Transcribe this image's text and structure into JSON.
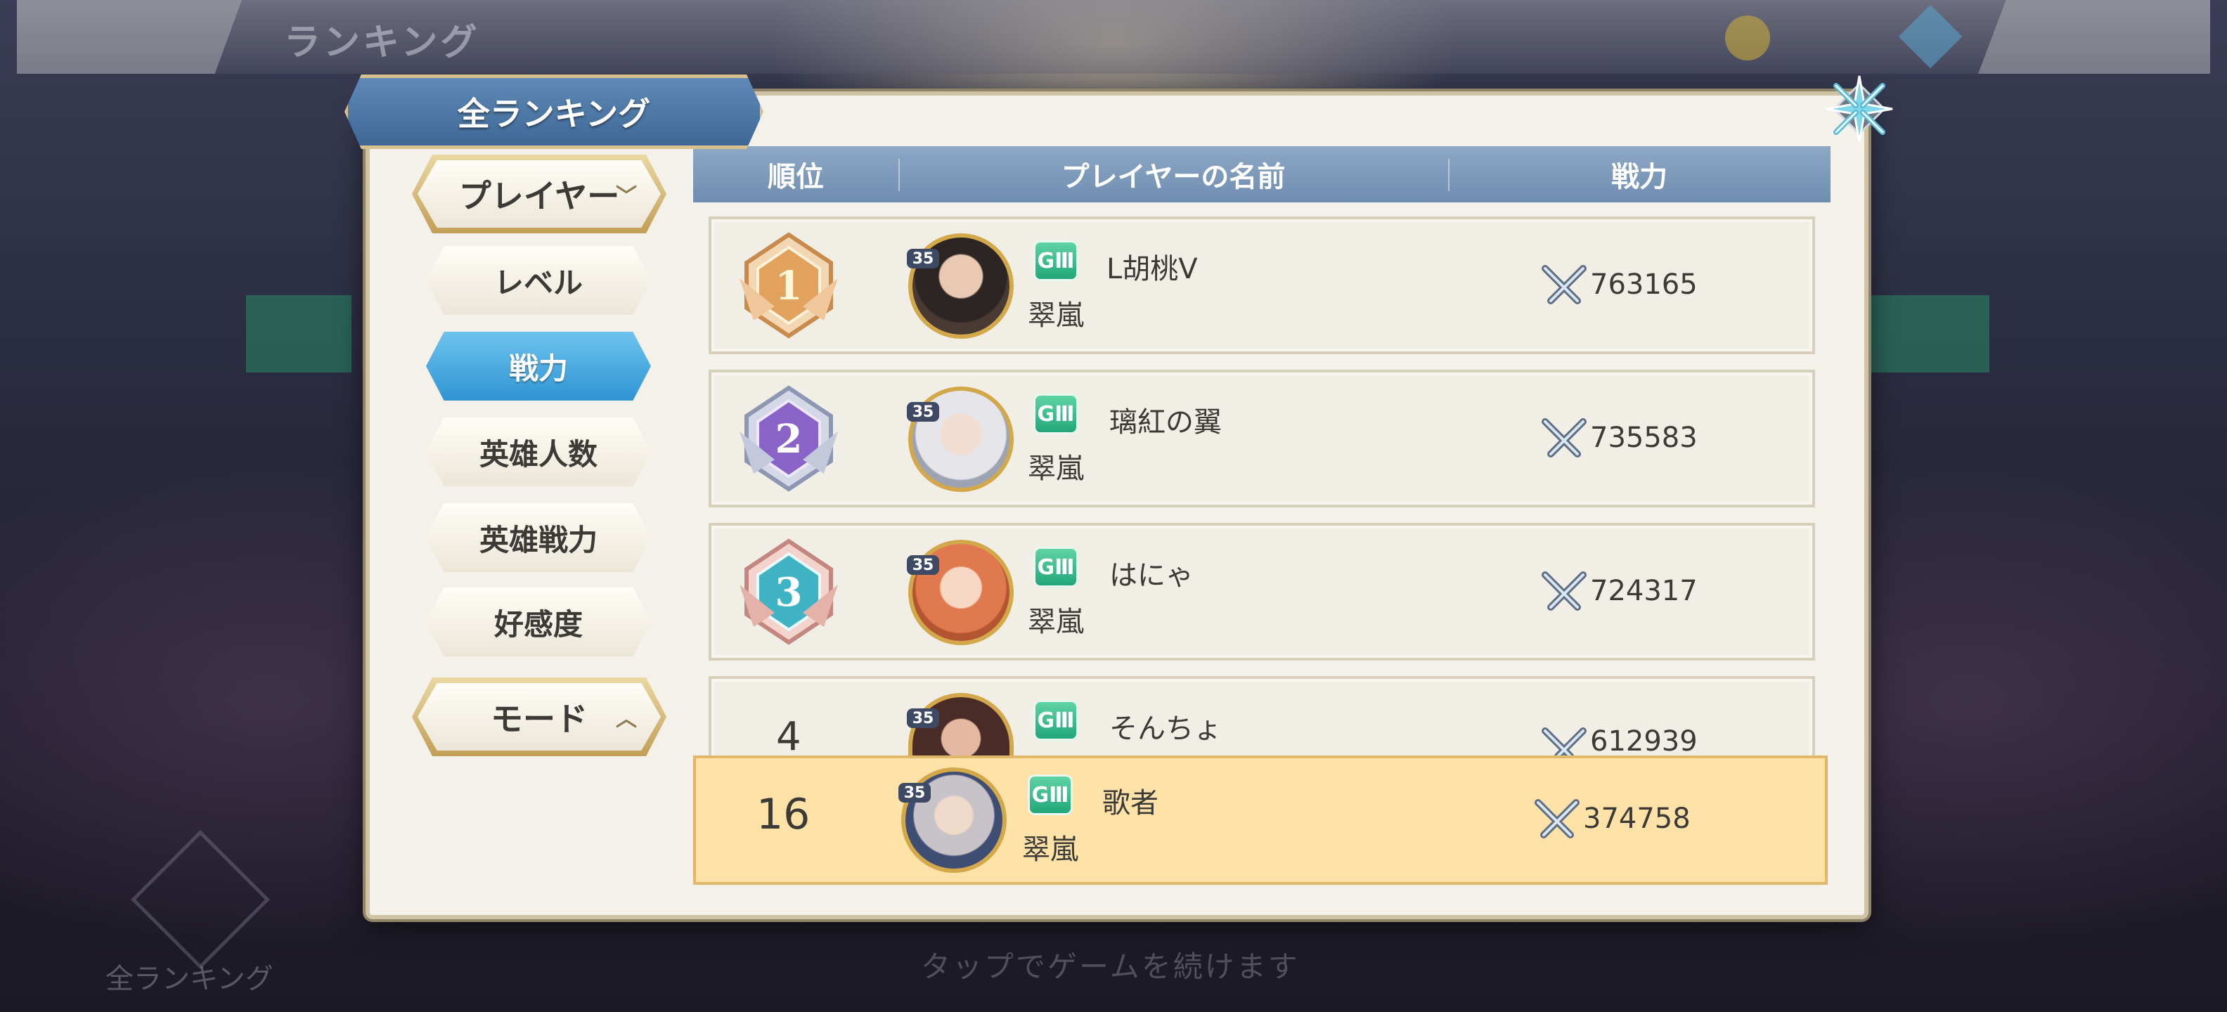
{
  "background": {
    "title": "ランキング",
    "footer_hint": "タップでゲームを続けます",
    "footer_label": "全ランキング"
  },
  "modal": {
    "title": "全ランキング"
  },
  "menu": {
    "dropdown_top": "プレイヤー",
    "items": [
      {
        "label": "レベル",
        "active": false
      },
      {
        "label": "戦力",
        "active": true
      },
      {
        "label": "英雄人数",
        "active": false
      },
      {
        "label": "英雄戦力",
        "active": false
      },
      {
        "label": "好感度",
        "active": false
      }
    ],
    "dropdown_bottom": "モード"
  },
  "table": {
    "headers": [
      "順位",
      "プレイヤーの名前",
      "戦力"
    ],
    "rows": [
      {
        "rank": "1",
        "level": "35",
        "name": "L胡桃V",
        "guild": "翠嵐",
        "power": "763165"
      },
      {
        "rank": "2",
        "level": "35",
        "name": "璃紅の翼",
        "guild": "翠嵐",
        "power": "735583"
      },
      {
        "rank": "3",
        "level": "35",
        "name": "はにゃ",
        "guild": "翠嵐",
        "power": "724317"
      },
      {
        "rank": "4",
        "level": "35",
        "name": "そんちょ",
        "guild": "",
        "power": "612939"
      }
    ],
    "self": {
      "rank": "16",
      "level": "35",
      "name": "歌者",
      "guild": "翠嵐",
      "power": "374758"
    }
  },
  "colors": {
    "header_bg": "#7f9bbd",
    "active_tab": "#3ba3e0",
    "self_row": "#ffe2a7",
    "rank1": "#e0a25c",
    "rank2": "#8a63c9",
    "rank3": "#3fb3c4"
  },
  "guild_icon_text": "GⅢ"
}
